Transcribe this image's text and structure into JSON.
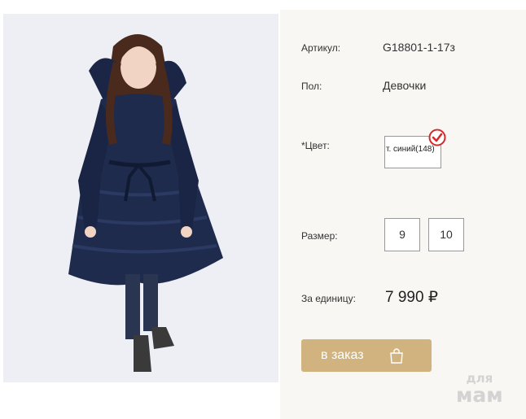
{
  "product": {
    "image_alt": "girl in navy blue down coat with fur hood",
    "colors": {
      "coat": "#1f2b4d",
      "hair": "#4a2a1c",
      "background": "#eeeff5"
    }
  },
  "details": {
    "article_label": "Артикул:",
    "article_value": "G18801-1-17з",
    "gender_label": "Пол:",
    "gender_value": "Девочки",
    "color_label": "*Цвет:",
    "color_value": "т. синий(148)",
    "size_label": "Размер:",
    "sizes": [
      "9",
      "10"
    ],
    "price_label": "За единицу:",
    "price_value": "7 990 ₽"
  },
  "order": {
    "button_label": "в заказ",
    "icon": "shopping-bag-icon",
    "button_color": "#d1b380"
  },
  "watermark": {
    "line1": "для",
    "line2": "мам"
  }
}
